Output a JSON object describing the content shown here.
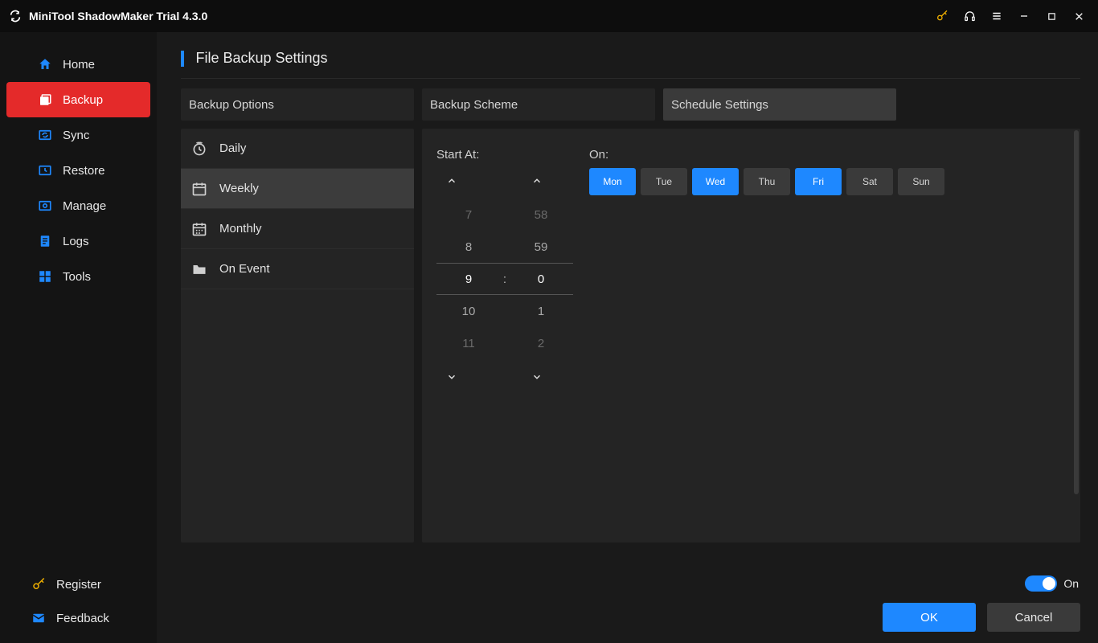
{
  "app": {
    "title": "MiniTool ShadowMaker Trial 4.3.0"
  },
  "sidebar": {
    "items": [
      {
        "label": "Home"
      },
      {
        "label": "Backup"
      },
      {
        "label": "Sync"
      },
      {
        "label": "Restore"
      },
      {
        "label": "Manage"
      },
      {
        "label": "Logs"
      },
      {
        "label": "Tools"
      }
    ],
    "bottom": {
      "register": "Register",
      "feedback": "Feedback"
    }
  },
  "page": {
    "title": "File Backup Settings"
  },
  "option_tabs": {
    "backup_options": "Backup Options",
    "backup_scheme": "Backup Scheme",
    "schedule_settings": "Schedule Settings"
  },
  "frequency": {
    "daily": "Daily",
    "weekly": "Weekly",
    "monthly": "Monthly",
    "on_event": "On Event"
  },
  "schedule": {
    "start_at_label": "Start At:",
    "on_label": "On:",
    "hours": {
      "m2": "7",
      "m1": "8",
      "sel": "9",
      "p1": "10",
      "p2": "11"
    },
    "mins": {
      "m2": "58",
      "m1": "59",
      "sel": "0",
      "p1": "1",
      "p2": "2"
    },
    "separator": ":",
    "days": [
      {
        "short": "Mon",
        "on": true
      },
      {
        "short": "Tue",
        "on": false
      },
      {
        "short": "Wed",
        "on": true
      },
      {
        "short": "Thu",
        "on": false
      },
      {
        "short": "Fri",
        "on": true
      },
      {
        "short": "Sat",
        "on": false
      },
      {
        "short": "Sun",
        "on": false
      }
    ]
  },
  "footer": {
    "toggle_label": "On",
    "ok": "OK",
    "cancel": "Cancel"
  }
}
